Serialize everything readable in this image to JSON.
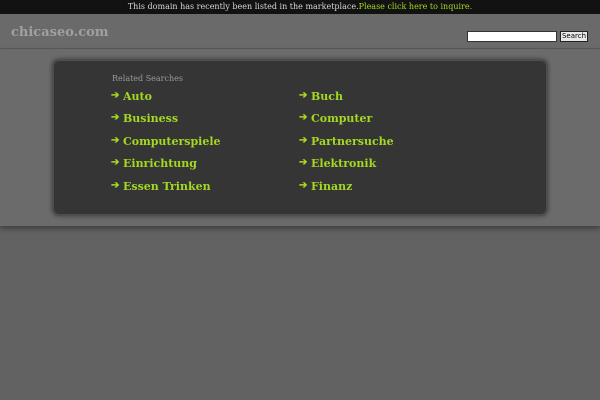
{
  "topbar": {
    "message": "This domain has recently been listed in the marketplace.",
    "link_text": "Please click here to inquire."
  },
  "header": {
    "logo": "chicaseo.com",
    "search": {
      "value": "",
      "button_label": "Search"
    }
  },
  "related": {
    "title": "Related Searches",
    "links": [
      {
        "label": "Auto",
        "icon": "arrow-right-icon"
      },
      {
        "label": "Buch",
        "icon": "arrow-right-icon"
      },
      {
        "label": "Business",
        "icon": "arrow-right-icon"
      },
      {
        "label": "Computer",
        "icon": "arrow-right-icon"
      },
      {
        "label": "Computerspiele",
        "icon": "arrow-right-icon"
      },
      {
        "label": "Partnersuche",
        "icon": "arrow-right-icon"
      },
      {
        "label": "Einrichtung",
        "icon": "arrow-right-icon"
      },
      {
        "label": "Elektronik",
        "icon": "arrow-right-icon"
      },
      {
        "label": "Essen Trinken",
        "icon": "arrow-right-icon"
      },
      {
        "label": "Finanz",
        "icon": "arrow-right-icon"
      }
    ]
  },
  "colors": {
    "accent": "#a4d821",
    "background": "#626262",
    "panel": "#353535",
    "topbar": "#121212"
  }
}
